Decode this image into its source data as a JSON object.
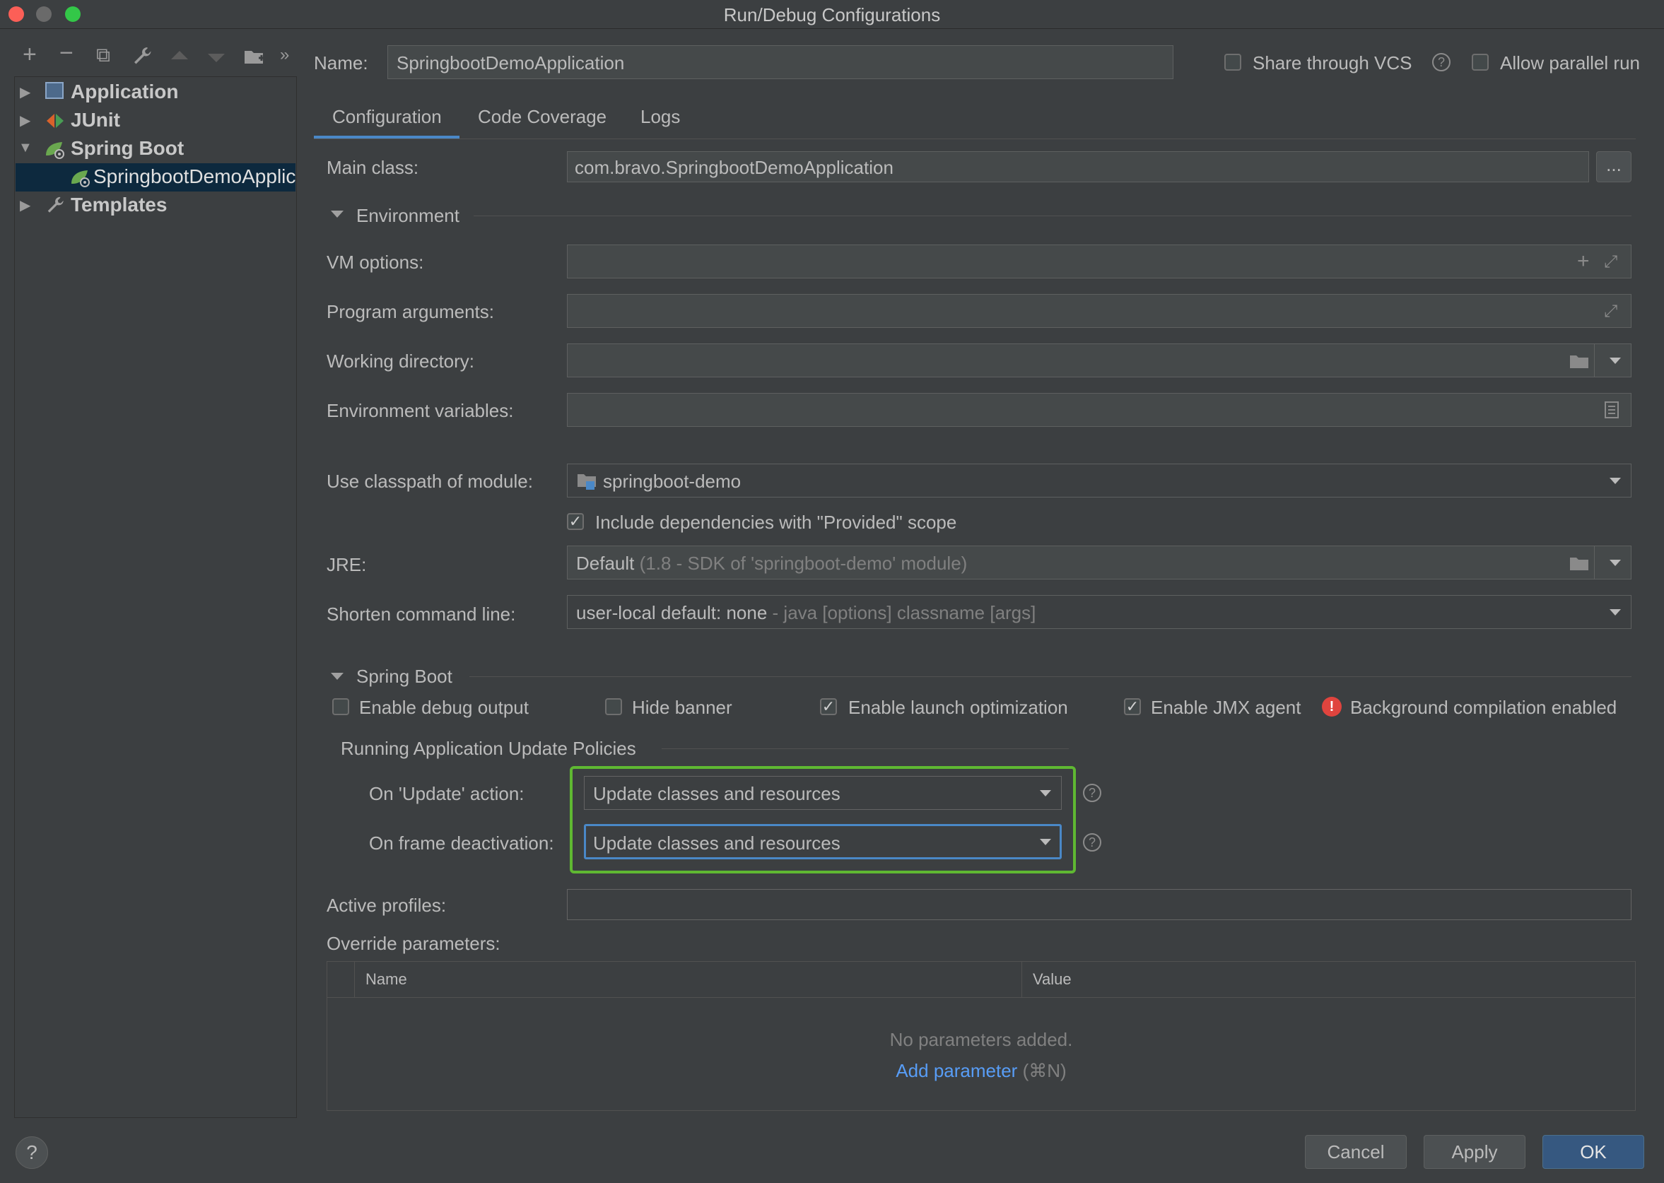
{
  "window": {
    "title": "Run/Debug Configurations"
  },
  "toolbar": {
    "icons": [
      "add-icon",
      "remove-icon",
      "copy-icon",
      "wrench-icon",
      "move-up-icon",
      "move-down-icon",
      "folder-icon",
      "more-icon"
    ]
  },
  "tree": {
    "items": [
      {
        "label": "Application"
      },
      {
        "label": "JUnit"
      },
      {
        "label": "Spring Boot"
      },
      {
        "label": "SpringbootDemoApplic"
      },
      {
        "label": "Templates"
      }
    ]
  },
  "header": {
    "name_label": "Name:",
    "name_value": "SpringbootDemoApplication",
    "share_vcs_label": "Share through VCS",
    "allow_parallel_label": "Allow parallel run"
  },
  "tabs": [
    {
      "label": "Configuration",
      "active": true
    },
    {
      "label": "Code Coverage",
      "active": false
    },
    {
      "label": "Logs",
      "active": false
    }
  ],
  "config": {
    "main_class_label": "Main class:",
    "main_class_value": "com.bravo.SpringbootDemoApplication",
    "browse_label": "...",
    "environment_section": "Environment",
    "vm_options_label": "VM options:",
    "vm_options_value": "",
    "program_args_label": "Program arguments:",
    "program_args_value": "",
    "working_dir_label": "Working directory:",
    "working_dir_value": "",
    "env_vars_label": "Environment variables:",
    "env_vars_value": "",
    "classpath_label": "Use classpath of module:",
    "classpath_value": "springboot-demo",
    "include_deps_label": "Include dependencies with \"Provided\" scope",
    "include_deps_checked": true,
    "jre_label": "JRE:",
    "jre_value": "Default",
    "jre_hint": "(1.8 - SDK of 'springboot-demo' module)",
    "shorten_label": "Shorten command line:",
    "shorten_value": "user-local default: none",
    "shorten_hint": "- java [options] classname [args]"
  },
  "spring_boot": {
    "section": "Spring Boot",
    "debug_output_label": "Enable debug output",
    "debug_output_checked": false,
    "hide_banner_label": "Hide banner",
    "hide_banner_checked": false,
    "launch_opt_label": "Enable launch optimization",
    "launch_opt_checked": true,
    "jmx_label": "Enable JMX agent",
    "jmx_checked": true,
    "bg_compile_label": "Background compilation enabled",
    "policies_title": "Running Application Update Policies",
    "on_update_label": "On 'Update' action:",
    "on_update_value": "Update classes and resources",
    "on_frame_label": "On frame deactivation:",
    "on_frame_value": "Update classes and resources",
    "active_profiles_label": "Active profiles:",
    "active_profiles_value": "",
    "override_label": "Override parameters:",
    "table_columns": [
      "Name",
      "Value"
    ],
    "empty_text": "No parameters added.",
    "add_param_label": "Add parameter",
    "add_param_shortcut": "(⌘N)"
  },
  "footer": {
    "help_label": "?",
    "cancel_label": "Cancel",
    "apply_label": "Apply",
    "ok_label": "OK"
  },
  "colors": {
    "accent": "#4a88c7",
    "highlight_box": "#5fb832",
    "error": "#e0443e",
    "link": "#589df6"
  }
}
